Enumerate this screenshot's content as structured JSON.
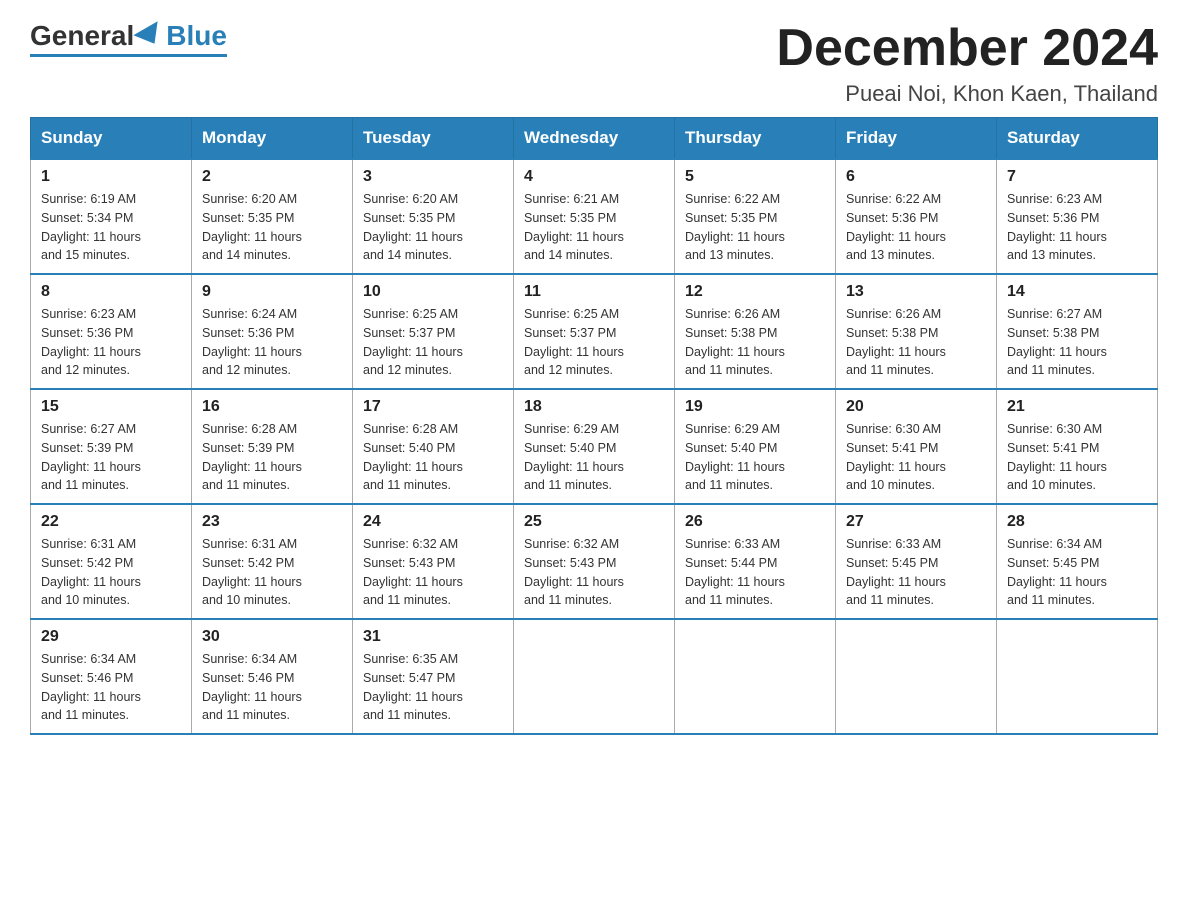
{
  "header": {
    "logo_general": "General",
    "logo_blue": "Blue",
    "month_title": "December 2024",
    "location": "Pueai Noi, Khon Kaen, Thailand"
  },
  "weekdays": [
    "Sunday",
    "Monday",
    "Tuesday",
    "Wednesday",
    "Thursday",
    "Friday",
    "Saturday"
  ],
  "weeks": [
    [
      {
        "day": "1",
        "info": "Sunrise: 6:19 AM\nSunset: 5:34 PM\nDaylight: 11 hours\nand 15 minutes."
      },
      {
        "day": "2",
        "info": "Sunrise: 6:20 AM\nSunset: 5:35 PM\nDaylight: 11 hours\nand 14 minutes."
      },
      {
        "day": "3",
        "info": "Sunrise: 6:20 AM\nSunset: 5:35 PM\nDaylight: 11 hours\nand 14 minutes."
      },
      {
        "day": "4",
        "info": "Sunrise: 6:21 AM\nSunset: 5:35 PM\nDaylight: 11 hours\nand 14 minutes."
      },
      {
        "day": "5",
        "info": "Sunrise: 6:22 AM\nSunset: 5:35 PM\nDaylight: 11 hours\nand 13 minutes."
      },
      {
        "day": "6",
        "info": "Sunrise: 6:22 AM\nSunset: 5:36 PM\nDaylight: 11 hours\nand 13 minutes."
      },
      {
        "day": "7",
        "info": "Sunrise: 6:23 AM\nSunset: 5:36 PM\nDaylight: 11 hours\nand 13 minutes."
      }
    ],
    [
      {
        "day": "8",
        "info": "Sunrise: 6:23 AM\nSunset: 5:36 PM\nDaylight: 11 hours\nand 12 minutes."
      },
      {
        "day": "9",
        "info": "Sunrise: 6:24 AM\nSunset: 5:36 PM\nDaylight: 11 hours\nand 12 minutes."
      },
      {
        "day": "10",
        "info": "Sunrise: 6:25 AM\nSunset: 5:37 PM\nDaylight: 11 hours\nand 12 minutes."
      },
      {
        "day": "11",
        "info": "Sunrise: 6:25 AM\nSunset: 5:37 PM\nDaylight: 11 hours\nand 12 minutes."
      },
      {
        "day": "12",
        "info": "Sunrise: 6:26 AM\nSunset: 5:38 PM\nDaylight: 11 hours\nand 11 minutes."
      },
      {
        "day": "13",
        "info": "Sunrise: 6:26 AM\nSunset: 5:38 PM\nDaylight: 11 hours\nand 11 minutes."
      },
      {
        "day": "14",
        "info": "Sunrise: 6:27 AM\nSunset: 5:38 PM\nDaylight: 11 hours\nand 11 minutes."
      }
    ],
    [
      {
        "day": "15",
        "info": "Sunrise: 6:27 AM\nSunset: 5:39 PM\nDaylight: 11 hours\nand 11 minutes."
      },
      {
        "day": "16",
        "info": "Sunrise: 6:28 AM\nSunset: 5:39 PM\nDaylight: 11 hours\nand 11 minutes."
      },
      {
        "day": "17",
        "info": "Sunrise: 6:28 AM\nSunset: 5:40 PM\nDaylight: 11 hours\nand 11 minutes."
      },
      {
        "day": "18",
        "info": "Sunrise: 6:29 AM\nSunset: 5:40 PM\nDaylight: 11 hours\nand 11 minutes."
      },
      {
        "day": "19",
        "info": "Sunrise: 6:29 AM\nSunset: 5:40 PM\nDaylight: 11 hours\nand 11 minutes."
      },
      {
        "day": "20",
        "info": "Sunrise: 6:30 AM\nSunset: 5:41 PM\nDaylight: 11 hours\nand 10 minutes."
      },
      {
        "day": "21",
        "info": "Sunrise: 6:30 AM\nSunset: 5:41 PM\nDaylight: 11 hours\nand 10 minutes."
      }
    ],
    [
      {
        "day": "22",
        "info": "Sunrise: 6:31 AM\nSunset: 5:42 PM\nDaylight: 11 hours\nand 10 minutes."
      },
      {
        "day": "23",
        "info": "Sunrise: 6:31 AM\nSunset: 5:42 PM\nDaylight: 11 hours\nand 10 minutes."
      },
      {
        "day": "24",
        "info": "Sunrise: 6:32 AM\nSunset: 5:43 PM\nDaylight: 11 hours\nand 11 minutes."
      },
      {
        "day": "25",
        "info": "Sunrise: 6:32 AM\nSunset: 5:43 PM\nDaylight: 11 hours\nand 11 minutes."
      },
      {
        "day": "26",
        "info": "Sunrise: 6:33 AM\nSunset: 5:44 PM\nDaylight: 11 hours\nand 11 minutes."
      },
      {
        "day": "27",
        "info": "Sunrise: 6:33 AM\nSunset: 5:45 PM\nDaylight: 11 hours\nand 11 minutes."
      },
      {
        "day": "28",
        "info": "Sunrise: 6:34 AM\nSunset: 5:45 PM\nDaylight: 11 hours\nand 11 minutes."
      }
    ],
    [
      {
        "day": "29",
        "info": "Sunrise: 6:34 AM\nSunset: 5:46 PM\nDaylight: 11 hours\nand 11 minutes."
      },
      {
        "day": "30",
        "info": "Sunrise: 6:34 AM\nSunset: 5:46 PM\nDaylight: 11 hours\nand 11 minutes."
      },
      {
        "day": "31",
        "info": "Sunrise: 6:35 AM\nSunset: 5:47 PM\nDaylight: 11 hours\nand 11 minutes."
      },
      {
        "day": "",
        "info": ""
      },
      {
        "day": "",
        "info": ""
      },
      {
        "day": "",
        "info": ""
      },
      {
        "day": "",
        "info": ""
      }
    ]
  ]
}
